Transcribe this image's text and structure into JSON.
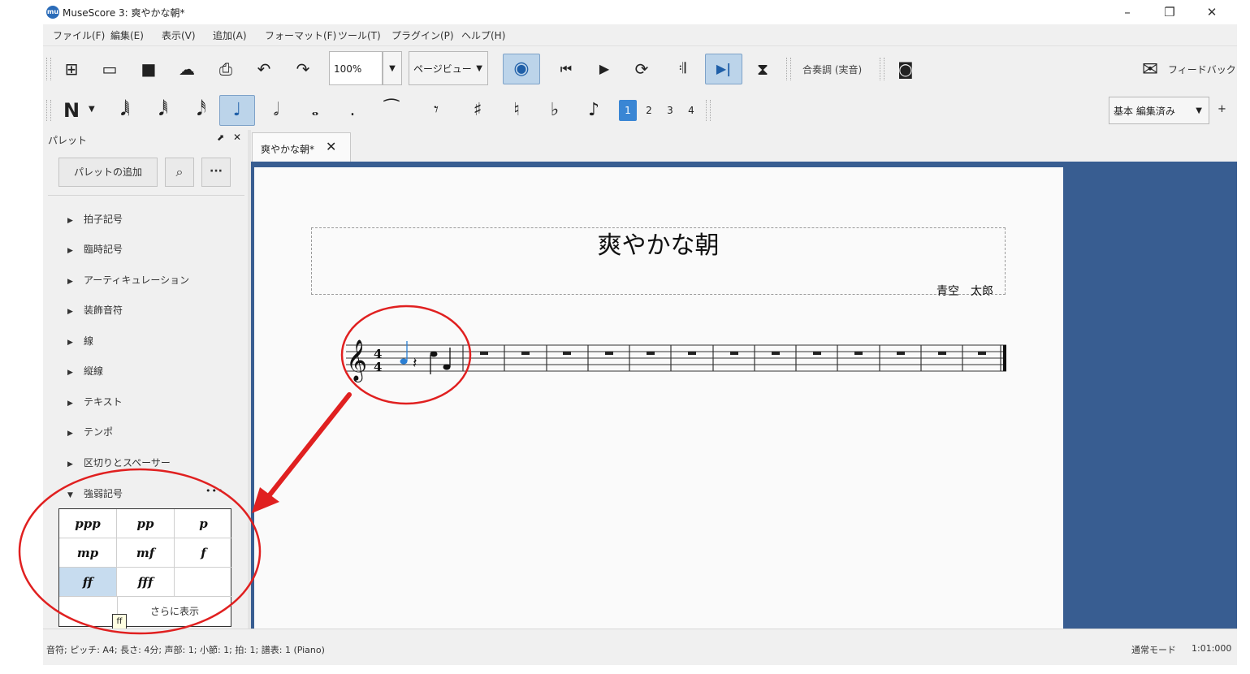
{
  "window": {
    "title": "MuseScore 3: 爽やかな朝*",
    "logo": "mu",
    "controls": {
      "minimize": "–",
      "restore": "❐",
      "close": "✕"
    }
  },
  "menu": [
    {
      "label": "ファイル(F)"
    },
    {
      "label": "編集(E)"
    },
    {
      "label": "表示(V)"
    },
    {
      "label": "追加(A)"
    },
    {
      "label": "フォーマット(F)"
    },
    {
      "label": "ツール(T)"
    },
    {
      "label": "プラグイン(P)"
    },
    {
      "label": "ヘルプ(H)"
    }
  ],
  "toolbar": {
    "zoom_value": "100%",
    "view_mode": "ページビュー",
    "concert_pitch": "合奏調 (実音)",
    "feedback": "フィードバック",
    "workspace": "基本 編集済み",
    "add": "+",
    "icons": {
      "new": "⊞",
      "open": "▭",
      "save": "■",
      "cloud": "☁",
      "print": "⎙",
      "undo": "↶",
      "redo": "↷",
      "midi": "◉",
      "rewind": "⏮",
      "play": "▶",
      "loop": "⟳",
      "repeat": "𝄇",
      "pan": "▶|",
      "metronome": "⧗",
      "camera": "◙",
      "mail": "✉"
    }
  },
  "note_input": {
    "mode": "N",
    "durations": [
      "𝅘𝅥𝅲",
      "𝅘𝅥𝅱",
      "𝅘𝅥𝅰",
      "♩",
      "𝅗𝅥",
      "𝅝",
      "."
    ],
    "symbols": [
      "⁀",
      "𝄾",
      "♯",
      "♮",
      "♭",
      "♪"
    ],
    "voices": [
      "1",
      "2",
      "3",
      "4"
    ]
  },
  "palette": {
    "title": "パレット",
    "add_button": "パレットの追加",
    "search_icon": "⌕",
    "more": "···",
    "header_icons": {
      "float": "⬈",
      "close": "✕"
    },
    "categories": [
      "拍子記号",
      "臨時記号",
      "アーティキュレーション",
      "装飾音符",
      "線",
      "縦線",
      "テキスト",
      "テンポ",
      "区切りとスペーサー"
    ],
    "expanded": {
      "name": "強弱記号",
      "more": "•••",
      "cells": [
        "ppp",
        "pp",
        "p",
        "mp",
        "mf",
        "f",
        "ff",
        "fff",
        ""
      ],
      "selected_index": 6,
      "show_more": "さらに表示",
      "tooltip": "ff"
    }
  },
  "tab": {
    "label": "爽やかな朝*",
    "close": "✕"
  },
  "score": {
    "title": "爽やかな朝",
    "composer": "青空　太郎",
    "rest_measures": 13
  },
  "status": {
    "left": "音符; ピッチ: A4; 長さ: 4分; 声部: 1; 小節: 1; 拍: 1; 譜表: 1 (Piano)",
    "mode": "通常モード",
    "position": "1:01:000"
  },
  "colors": {
    "accent": "#3a86d4",
    "score_background": "#385d91",
    "annotation": "#e02020",
    "selected_note": "#2a7fd4"
  }
}
